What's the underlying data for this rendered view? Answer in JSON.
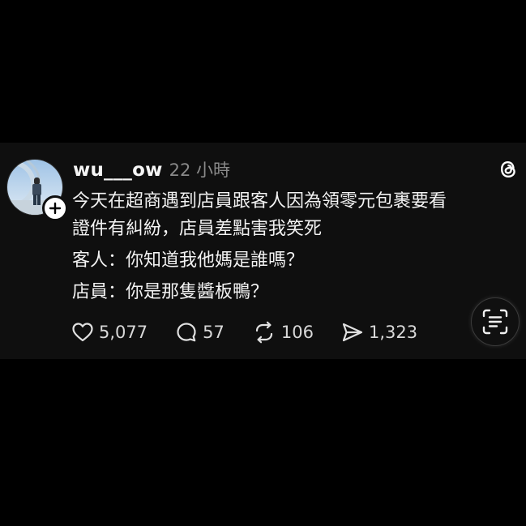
{
  "post": {
    "username": "wu___ow",
    "time": "22 小時",
    "lines": [
      "今天在超商遇到店員跟客人因為領零元包裹要看",
      "證件有糾紛，店員差點害我笑死",
      "客人：你知道我他媽是誰嗎？",
      "店員：你是那隻醬板鴨？"
    ],
    "stats": {
      "likes": "5,077",
      "replies": "57",
      "reposts": "106",
      "shares": "1,323"
    }
  },
  "icons": {
    "follow": "plus-icon",
    "app": "threads-logo-icon",
    "like": "heart-icon",
    "reply": "comment-bubble-icon",
    "repost": "repost-arrows-icon",
    "share": "send-icon",
    "scan": "text-scan-icon"
  },
  "colors": {
    "background": "#000000",
    "card": "#0f0f0f",
    "text": "#f2f2f2",
    "muted": "#8a8a8a"
  }
}
